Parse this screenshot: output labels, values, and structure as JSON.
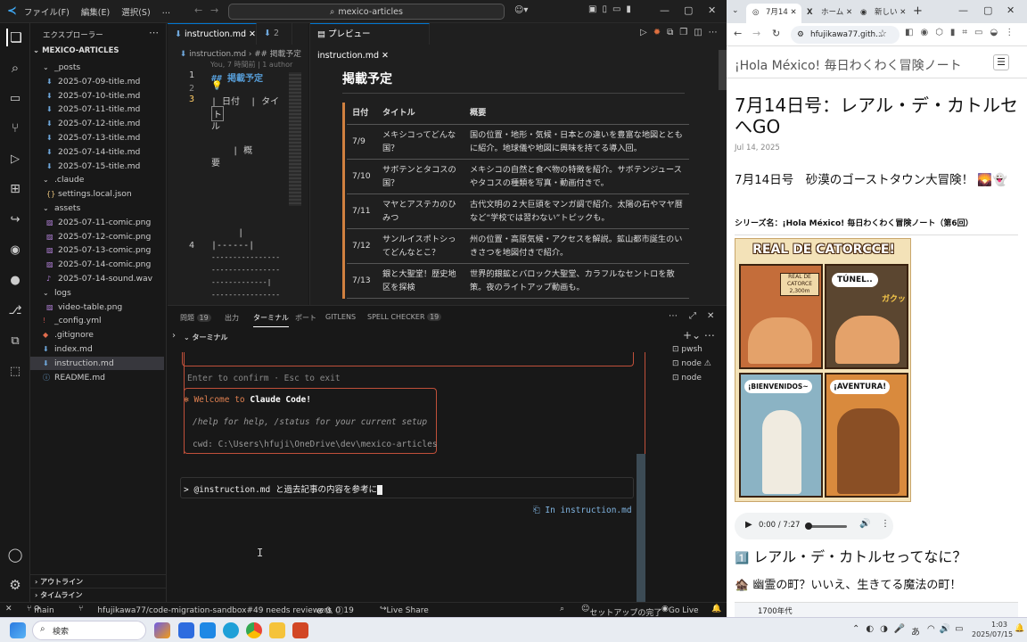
{
  "vscode": {
    "menus": [
      "ファイル(F)",
      "編集(E)",
      "選択(S)",
      "…"
    ],
    "search_text": "mexico-articles",
    "explorer": {
      "header": "エクスプローラー",
      "root": "MEXICO-ARTICLES",
      "items": [
        {
          "label": "_posts",
          "kind": "folder",
          "depth": 1
        },
        {
          "label": "2025-07-09-title.md",
          "kind": "md",
          "depth": 2
        },
        {
          "label": "2025-07-10-title.md",
          "kind": "md",
          "depth": 2
        },
        {
          "label": "2025-07-11-title.md",
          "kind": "md",
          "depth": 2
        },
        {
          "label": "2025-07-12-title.md",
          "kind": "md",
          "depth": 2
        },
        {
          "label": "2025-07-13-title.md",
          "kind": "md",
          "depth": 2
        },
        {
          "label": "2025-07-14-title.md",
          "kind": "md",
          "depth": 2
        },
        {
          "label": "2025-07-15-title.md",
          "kind": "md",
          "depth": 2
        },
        {
          "label": ".claude",
          "kind": "folder",
          "depth": 1
        },
        {
          "label": "settings.local.json",
          "kind": "json",
          "depth": 2
        },
        {
          "label": "assets",
          "kind": "folder",
          "depth": 1
        },
        {
          "label": "2025-07-11-comic.png",
          "kind": "png",
          "depth": 2
        },
        {
          "label": "2025-07-12-comic.png",
          "kind": "png",
          "depth": 2
        },
        {
          "label": "2025-07-13-comic.png",
          "kind": "png",
          "depth": 2
        },
        {
          "label": "2025-07-14-comic.png",
          "kind": "png",
          "depth": 2
        },
        {
          "label": "2025-07-14-sound.wav",
          "kind": "wav",
          "depth": 2
        },
        {
          "label": "logs",
          "kind": "folder",
          "depth": 1
        },
        {
          "label": "video-table.png",
          "kind": "png",
          "depth": 2
        },
        {
          "label": "_config.yml",
          "kind": "yml",
          "depth": 1
        },
        {
          "label": ".gitignore",
          "kind": "git",
          "depth": 1
        },
        {
          "label": "index.md",
          "kind": "md",
          "depth": 1
        },
        {
          "label": "instruction.md",
          "kind": "md",
          "depth": 1
        },
        {
          "label": "README.md",
          "kind": "info",
          "depth": 1
        }
      ],
      "outline": "アウトライン",
      "timeline": "タイムライン"
    },
    "editor": {
      "tab1": "instruction.md",
      "tab2": "2",
      "breadcrumb": "instruction.md",
      "breadcrumb2": "## 掲載予定",
      "blame": "You, 7 時間前 | 1 author",
      "line_numbers": [
        "1",
        "2",
        "3",
        "4"
      ],
      "lines": [
        "## 掲載予定",
        "💡",
        "| 日付  | タイ",
        "ト",
        "ル",
        "    | 概",
        "要",
        "     |",
        "|------|",
        "----------------",
        "----------------",
        "-------------|",
        "----------------"
      ]
    },
    "preview": {
      "tab": "プレビュー instruction.md",
      "heading": "掲載予定",
      "columns": [
        "日付",
        "タイトル",
        "概要"
      ],
      "rows": [
        [
          "7/9",
          "メキシコってどんな国？",
          "国の位置・地形・気候・日本との違いを豊富な地図とともに紹介。地球儀や地図に興味を持てる導入回。"
        ],
        [
          "7/10",
          "サボテンとタコスの国？",
          "メキシコの自然と食べ物の特徴を紹介。サボテンジュースやタコスの種類を写真・動画付きで。"
        ],
        [
          "7/11",
          "マヤとアステカのひみつ",
          "古代文明の２大巨頭をマンガ調で紹介。太陽の石やマヤ暦など“学校では習わない”トピックも。"
        ],
        [
          "7/12",
          "サンルイスポトシってどんなとこ？",
          "州の位置・高原気候・アクセスを解説。鉱山都市誕生のいきさつを地図付きで紹介。"
        ],
        [
          "7/13",
          "銀と大聖堂！歴史地区を探検",
          "世界的銀鉱とバロック大聖堂、カラフルなセントロを散策。夜のライトアップ動画も。"
        ]
      ]
    },
    "panel": {
      "tabs": [
        "問題",
        "出力",
        "ターミナル",
        "ポート",
        "GITLENS",
        "SPELL CHECKER"
      ],
      "problems_count": "19",
      "spell_count": "19",
      "terminal_label": "ターミナル",
      "sessions": [
        "pwsh",
        "node",
        "node"
      ],
      "confirm": "Enter to confirm · Esc to exit",
      "welcome_prefix": "✻ Welcome to ",
      "welcome_bold": "Claude Code!",
      "help": "/help for help, /status for your current setup",
      "cwd": "cwd: C:\\Users\\hfuji\\OneDrive\\dev\\mexico-articles",
      "prompt": "> @instruction.md  と過去記事の内容を参考に",
      "in_file": "In instruction.md"
    },
    "status": {
      "branch": "main",
      "pr": "hfujikawa77/code-migration-sandbox#49 needs reviewers",
      "errors": "0",
      "warnings": "0",
      "info": "19",
      "live_share": "Live Share",
      "setup": "セットアップの完了",
      "go_live": "Go Live"
    }
  },
  "browser": {
    "tabs": [
      "7月14",
      "ホーム",
      "新しい"
    ],
    "url": "hfujikawa77.gith...",
    "site_title": "¡Hola México! 毎日わくわく冒険ノート",
    "post_title": "7月14日号：レアル・デ・カトルセへGO",
    "date": "Jul 14, 2025",
    "subtitle": "7月14日号　砂漠のゴーストタウン大冒険！ 🌄👻",
    "series": "シリーズ名：¡Hola México! 毎日わくわく冒険ノート（第6回）",
    "comic": {
      "sign": "REAL DE CATORCCE!",
      "sub": "REAL DE CATORCE 2,300m",
      "p2": "TÚNEL..",
      "p2b": "ガクッ",
      "p3": "¡BIENVENIDOS~",
      "p4": "¡AVENTURA!"
    },
    "audio_time": "0:00 / 7:27",
    "h2": "レアル・デ・カトルセってなに？",
    "h2_num": "1️⃣",
    "h3": "🏚️ 幽霊の町？いいえ、生きてる魔法の町！",
    "table_cell": "1700年代"
  },
  "taskbar": {
    "search": "検索",
    "ime": "あ",
    "time": "1:03",
    "date": "2025/07/15"
  }
}
